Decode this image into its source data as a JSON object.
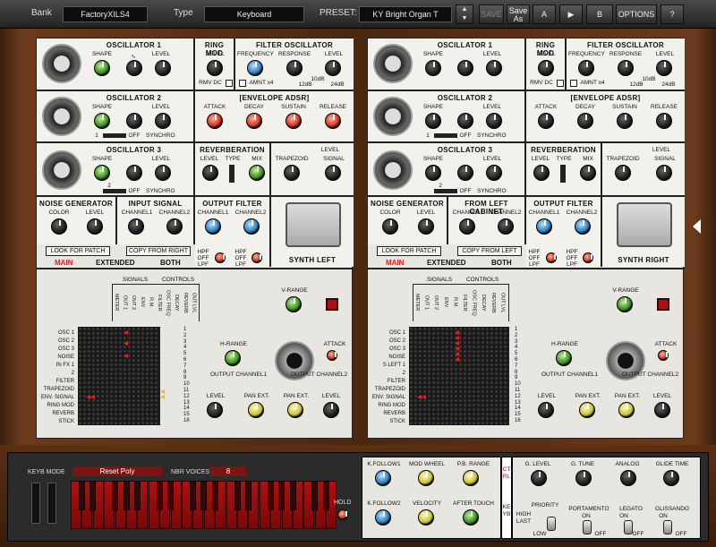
{
  "topbar": {
    "bank": "Bank",
    "preset_name": "FactoryXILS4",
    "type": "Type",
    "type_value": "Keyboard",
    "preset": "PRESET:",
    "preset_value": "KY Bright Organ T",
    "save": "SAVE",
    "save_as": "Save As",
    "a": "A",
    "b": "B",
    "options": "OPTIONS",
    "help": "?"
  },
  "left": {
    "osc1": "OSCILLATOR 1",
    "osc2": "OSCILLATOR 2",
    "osc3": "OSCILLATOR 3",
    "ring": "RING MOD",
    "filt": "FILTER OSCILLATOR",
    "env": "[ENVELOPE  ADSR]",
    "rev": "REVERBERATION",
    "noise": "NOISE GENERATOR",
    "input": "INPUT SIGNAL",
    "outf": "OUTPUT FILTER",
    "synth": "SYNTH LEFT",
    "look": "LOOK FOR PATCH",
    "copy": "COPY FROM RIGHT"
  },
  "right": {
    "osc1": "OSCILLATOR 1",
    "osc2": "OSCILLATOR 2",
    "osc3": "OSCILLATOR 3",
    "ring": "RING MOD",
    "filt": "FILTER OSCILLATOR",
    "env": "[ENVELOPE  ADSR]",
    "rev": "REVERBERATION",
    "noise": "NOISE GENERATOR",
    "input": "FROM LEFT CABINET",
    "outf": "OUTPUT FILTER",
    "synth": "SYNTH RIGHT",
    "look": "LOOK FOR PATCH",
    "copy": "COPY FROM LEFT"
  },
  "labels": {
    "shape": "SHAPE",
    "level": "LEVEL",
    "frequency": "FREQUENCY",
    "response": "RESPONSE",
    "attack": "ATTACK",
    "decay": "DECAY",
    "sustain": "SUSTAIN",
    "release": "RELEASE",
    "type": "TYPE",
    "mix": "MIX",
    "trapezoid": "TRAPEZOID",
    "signal": "SIGNAL",
    "color": "COLOR",
    "channel1": "CHANNEL1",
    "channel2": "CHANNEL2",
    "rmv_dc": "RMV DC",
    "amnt": "AMNT x4",
    "db10": "10dB",
    "db12": "12dB",
    "db24": "24dB",
    "off": "OFF",
    "synchro": "SYNCHRO",
    "one": "1",
    "two": "2",
    "hpf": "HPF",
    "opf": "OFF",
    "lpf": "LPF",
    "signals": "SIGNALS",
    "controls": "CONTROLS",
    "vrange": "V-RANGE",
    "hrange": "H-RANGE",
    "output_ch1": "OUTPUT CHANNEL1",
    "output_ch2": "OUTPUT CHANNEL2",
    "pan_ext": "PAN EXT.",
    "low": "LOW"
  },
  "tabs": {
    "main": "MAIN",
    "extended": "EXTENDED",
    "both": "BOTH"
  },
  "matrix_cols": [
    "METER",
    "OUT 1",
    "OUT 2",
    "ENV",
    "R.M.",
    "FILTER",
    "OSC FREQ",
    "DECAY",
    "REVERB",
    "OUT LVL"
  ],
  "matrix_rows_left": [
    "OSC 1",
    "OSC 2",
    "OSC 3",
    "NOISE",
    "IN FX 1",
    "2",
    "FILTER",
    "TRAPEZOID",
    "ENV. SIGNAL",
    "RING MOD",
    "REVERB",
    "STICK"
  ],
  "matrix_rows_right": [
    "OSC 1",
    "OSC 2",
    "OSC 3",
    "NOISE",
    "S LEFT 1",
    "2",
    "FILTER",
    "TRAPEZOID",
    "ENV. SIGNAL",
    "RING MOD",
    "REVERB",
    "STICK"
  ],
  "matrix_nums": [
    "1",
    "2",
    "3",
    "4",
    "5",
    "6",
    "7",
    "8",
    "9",
    "10",
    "11",
    "12",
    "13",
    "14",
    "15",
    "16"
  ],
  "keyboard": {
    "keyb_mode": "KEYB MODE",
    "mode_value": "Reset Poly",
    "nbr_voices": "NBR VOICES",
    "voices_value": "8",
    "hold": "HOLD",
    "kfollow1": "K.FOLLOW1",
    "modwheel": "MOD WHEEL",
    "pbrange": "P.B. RANGE",
    "kfollow2": "K.FOLLOW2",
    "velocity": "VELOCITY",
    "aftertouch": "AFTER TOUCH",
    "glevel": "G. LEVEL",
    "gtune": "G. TUNE",
    "analog": "ANALOG",
    "glide": "GLIDE TIME",
    "priority": "PRIORITY",
    "high": "HIGH",
    "last": "LAST",
    "low": "LOW",
    "portamento": "PORTAMENTO",
    "legato": "LEGATO",
    "glissando": "GLISSANDO",
    "on": "ON",
    "off": "OFF",
    "ctrl": "CTRL",
    "keyb": "KEYB"
  }
}
